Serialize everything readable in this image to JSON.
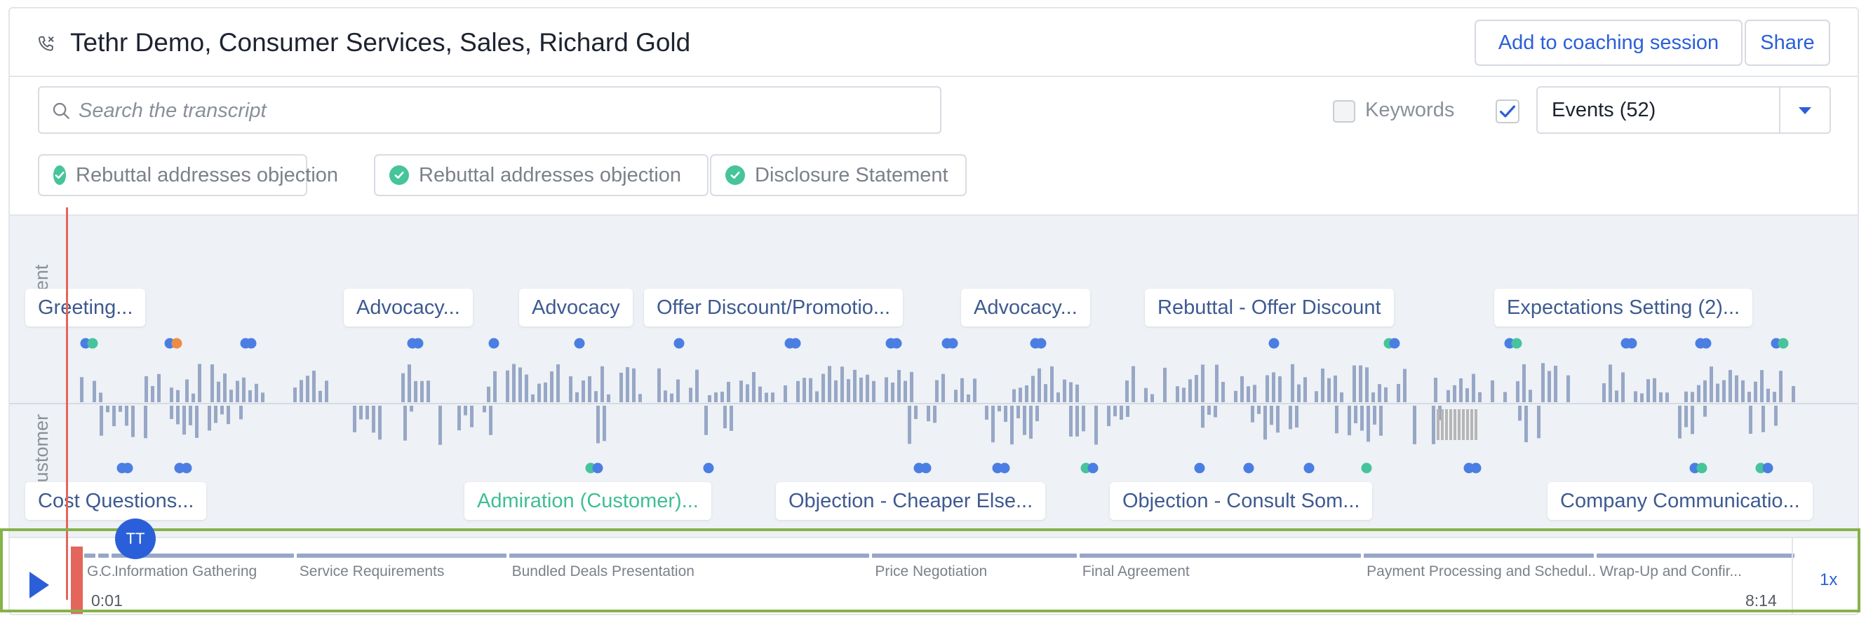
{
  "header": {
    "title": "Tethr Demo, Consumer Services, Sales, Richard Gold",
    "add_coaching_label": "Add to coaching session",
    "share_label": "Share"
  },
  "toolbar": {
    "search_placeholder": "Search the transcript",
    "keywords_label": "Keywords",
    "keywords_checked": false,
    "events_checked": true,
    "events_value": "Events (52)"
  },
  "chips": [
    {
      "label": "Rebuttal addresses objection"
    },
    {
      "label": "Rebuttal addresses objection"
    },
    {
      "label": "Disclosure Statement"
    }
  ],
  "timeline": {
    "agent_label": "Agent",
    "customer_label": "Customer",
    "agent_tags": [
      {
        "label": "Greeting...",
        "color": "#3e5a90"
      },
      {
        "label": "Advocacy...",
        "color": "#3e5a90"
      },
      {
        "label": "Advocacy",
        "color": "#3e5a90"
      },
      {
        "label": "Offer Discount/Promotio...",
        "color": "#3e5a90"
      },
      {
        "label": "Advocacy...",
        "color": "#3e5a90"
      },
      {
        "label": "Rebuttal - Offer Discount",
        "color": "#3e5a90"
      },
      {
        "label": "Expectations Setting (2)...",
        "color": "#3e5a90"
      }
    ],
    "customer_tags": [
      {
        "label": "Cost Questions...",
        "color": "#3e5a90"
      },
      {
        "label": "Admiration (Customer)...",
        "color": "#3fbf91"
      },
      {
        "label": "Objection - Cheaper Else...",
        "color": "#3e5a90"
      },
      {
        "label": "Objection - Consult Som...",
        "color": "#3e5a90"
      },
      {
        "label": "Company Communicatio...",
        "color": "#3e5a90"
      }
    ],
    "colors": {
      "bar": "#97a7c6",
      "dot_blue": "#4a7ee3",
      "dot_green": "#46c49b",
      "dot_orange": "#ee8c44",
      "playhead": "#e4655b"
    }
  },
  "player": {
    "avatar_initials": "TT",
    "current_time": "0:01",
    "total_time": "8:14",
    "speed": "1x",
    "progress": 0.002,
    "segments": [
      {
        "label": "G...",
        "start": 0.0,
        "end": 0.008
      },
      {
        "label": "C...",
        "start": 0.008,
        "end": 0.016
      },
      {
        "label": "Information Gathering",
        "start": 0.016,
        "end": 0.124
      },
      {
        "label": "Service Requirements",
        "start": 0.124,
        "end": 0.248
      },
      {
        "label": "Bundled Deals Presentation",
        "start": 0.248,
        "end": 0.46
      },
      {
        "label": "Price Negotiation",
        "start": 0.46,
        "end": 0.581
      },
      {
        "label": "Final Agreement",
        "start": 0.581,
        "end": 0.747
      },
      {
        "label": "Payment Processing and Schedul...",
        "start": 0.747,
        "end": 0.883
      },
      {
        "label": "Wrap-Up and Confir...",
        "start": 0.883,
        "end": 1.0
      }
    ]
  }
}
